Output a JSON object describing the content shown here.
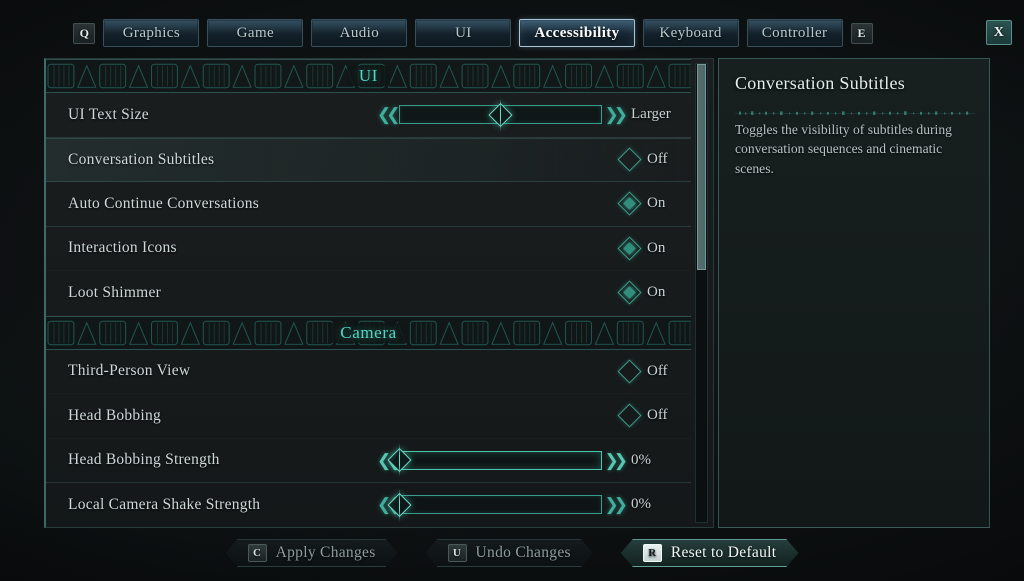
{
  "tabs": {
    "prev_key": "Q",
    "next_key": "E",
    "close_key": "X",
    "items": [
      {
        "label": "Graphics",
        "active": false
      },
      {
        "label": "Game",
        "active": false
      },
      {
        "label": "Audio",
        "active": false
      },
      {
        "label": "UI",
        "active": false
      },
      {
        "label": "Accessibility",
        "active": true
      },
      {
        "label": "Keyboard",
        "active": false
      },
      {
        "label": "Controller",
        "active": false
      }
    ]
  },
  "sections": [
    {
      "title": "UI",
      "rows": [
        {
          "label": "UI Text Size",
          "type": "slider",
          "value": "Larger",
          "percent": 50,
          "bright": false,
          "selected": false,
          "group_end": true
        },
        {
          "label": "Conversation Subtitles",
          "type": "toggle",
          "value": "Off",
          "on": false,
          "selected": true,
          "group_end": false
        },
        {
          "label": "Auto Continue Conversations",
          "type": "toggle",
          "value": "On",
          "on": true,
          "selected": false,
          "group_end": true
        },
        {
          "label": "Interaction Icons",
          "type": "toggle",
          "value": "On",
          "on": true,
          "selected": false,
          "group_end": false
        },
        {
          "label": "Loot Shimmer",
          "type": "toggle",
          "value": "On",
          "on": true,
          "selected": false,
          "group_end": false
        }
      ]
    },
    {
      "title": "Camera",
      "rows": [
        {
          "label": "Third-Person View",
          "type": "toggle",
          "value": "Off",
          "on": false,
          "selected": false,
          "group_end": false
        },
        {
          "label": "Head Bobbing",
          "type": "toggle",
          "value": "Off",
          "on": false,
          "selected": false,
          "group_end": false
        },
        {
          "label": "Head Bobbing Strength",
          "type": "slider",
          "value": "0%",
          "percent": 0,
          "bright": true,
          "selected": false,
          "group_end": true
        },
        {
          "label": "Local Camera Shake Strength",
          "type": "slider",
          "value": "0%",
          "percent": 0,
          "bright": false,
          "selected": false,
          "group_end": false
        }
      ]
    }
  ],
  "scrollbar": {
    "thumb_top_percent": 0,
    "thumb_height_percent": 45
  },
  "info": {
    "title": "Conversation Subtitles",
    "description": "Toggles the visibility of subtitles during conversation sequences and cinematic scenes."
  },
  "actions": [
    {
      "key": "C",
      "label": "Apply Changes",
      "highlight": false
    },
    {
      "key": "U",
      "label": "Undo Changes",
      "highlight": false
    },
    {
      "key": "R",
      "label": "Reset to Default",
      "highlight": true
    }
  ],
  "colors": {
    "accent_teal": "#4fd8c4",
    "toggle_teal": "#3f9e8d",
    "panel_border": "#5fa59e",
    "text_primary": "#cfd8d8"
  }
}
